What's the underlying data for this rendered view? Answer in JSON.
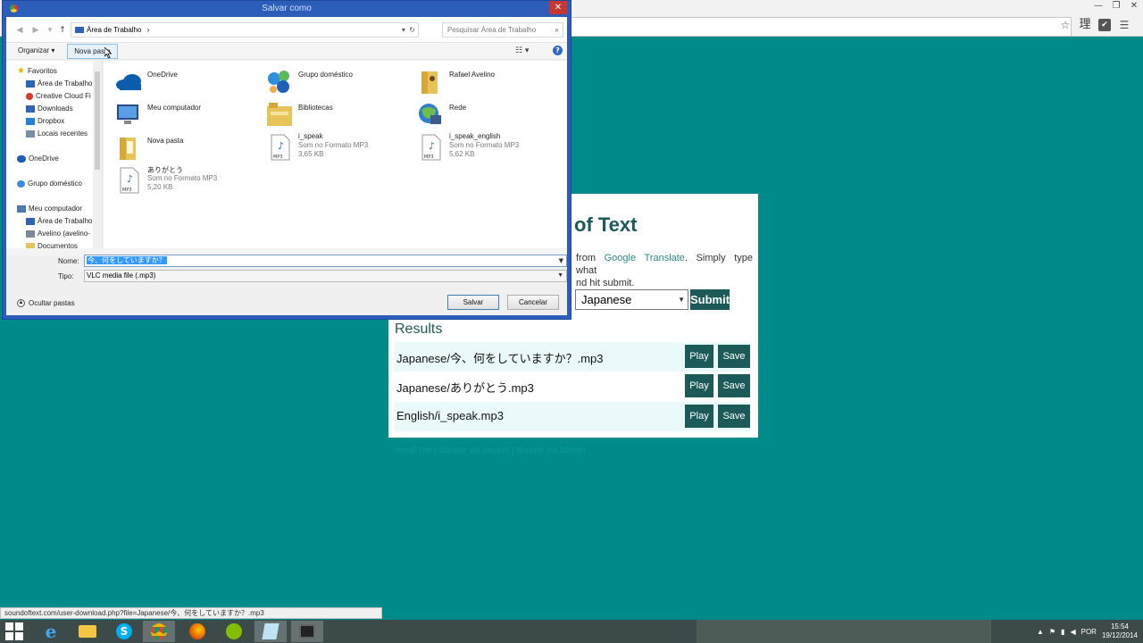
{
  "browser": {
    "ext_kanji": "理",
    "window_controls": [
      "—",
      "❐",
      "✕"
    ]
  },
  "page": {
    "heading": "of Text",
    "intro_pre": "from",
    "intro_link": "Google Translate",
    "intro_post": ". Simply type what",
    "intro_line2": "nd hit submit.",
    "language_selected": "Japanese",
    "submit_label": "Submit",
    "results_title": "Results",
    "results": [
      {
        "file": "Japanese/今、何をしていますか？.mp3",
        "play": "Play",
        "save": "Save"
      },
      {
        "file": "Japanese/ありがとう.mp3",
        "play": "Play",
        "save": "Save"
      },
      {
        "file": "English/i_speak.mp3",
        "play": "Play",
        "save": "Save"
      }
    ],
    "footer": "email me | donate via paypal | donate via bitcoin"
  },
  "status_url": "soundoftext.com/user-download.php?file=Japanese/今、何をしていますか？.mp3",
  "dialog": {
    "title": "Salvar como",
    "address": "Área de Trabalho",
    "address_sep": "›",
    "search_placeholder": "Pesquisar Área de Trabalho",
    "organize": "Organizar",
    "new_folder": "Nova pasta",
    "nav": {
      "favorites": "Favoritos",
      "fav_items": [
        "Área de Trabalho",
        "Creative Cloud Fi",
        "Downloads",
        "Dropbox",
        "Locais recentes"
      ],
      "onedrive": "OneDrive",
      "homegroup": "Grupo doméstico",
      "computer": "Meu computador",
      "computer_items": [
        "Área de Trabalho",
        "Avelino (avelino-",
        "Documentos"
      ]
    },
    "items": [
      {
        "name": "OneDrive",
        "icon": "onedrive-icon"
      },
      {
        "name": "Grupo doméstico",
        "icon": "homegroup-icon"
      },
      {
        "name": "Rafael Avelino",
        "icon": "user-folder-icon"
      },
      {
        "name": "Meu computador",
        "icon": "computer-icon"
      },
      {
        "name": "Bibliotecas",
        "icon": "libraries-icon"
      },
      {
        "name": "Rede",
        "icon": "network-icon"
      },
      {
        "name": "Nova pasta",
        "icon": "folder-icon"
      },
      {
        "name": "i_speak",
        "type": "Som no Formato MP3",
        "size": "3,65 KB",
        "icon": "mp3-file-icon"
      },
      {
        "name": "i_speak_english",
        "type": "Som no Formato MP3",
        "size": "5,62 KB",
        "icon": "mp3-file-icon"
      },
      {
        "name": "ありがとう",
        "type": "Som no Formato MP3",
        "size": "5,20 KB",
        "icon": "mp3-file-icon"
      }
    ],
    "name_label": "Nome:",
    "name_value": "今、何をしていますか？",
    "type_label": "Tipo:",
    "type_value": "VLC media file (.mp3)",
    "hide_folders": "Ocultar pastas",
    "save_label": "Salvar",
    "cancel_label": "Cancelar"
  },
  "tray": {
    "lang": "POR",
    "time": "15:54",
    "date": "19/12/2014"
  },
  "colors": {
    "page_bg": "#008b8b",
    "accent": "#1c5a5a",
    "dialog_frame": "#2c5db8"
  }
}
